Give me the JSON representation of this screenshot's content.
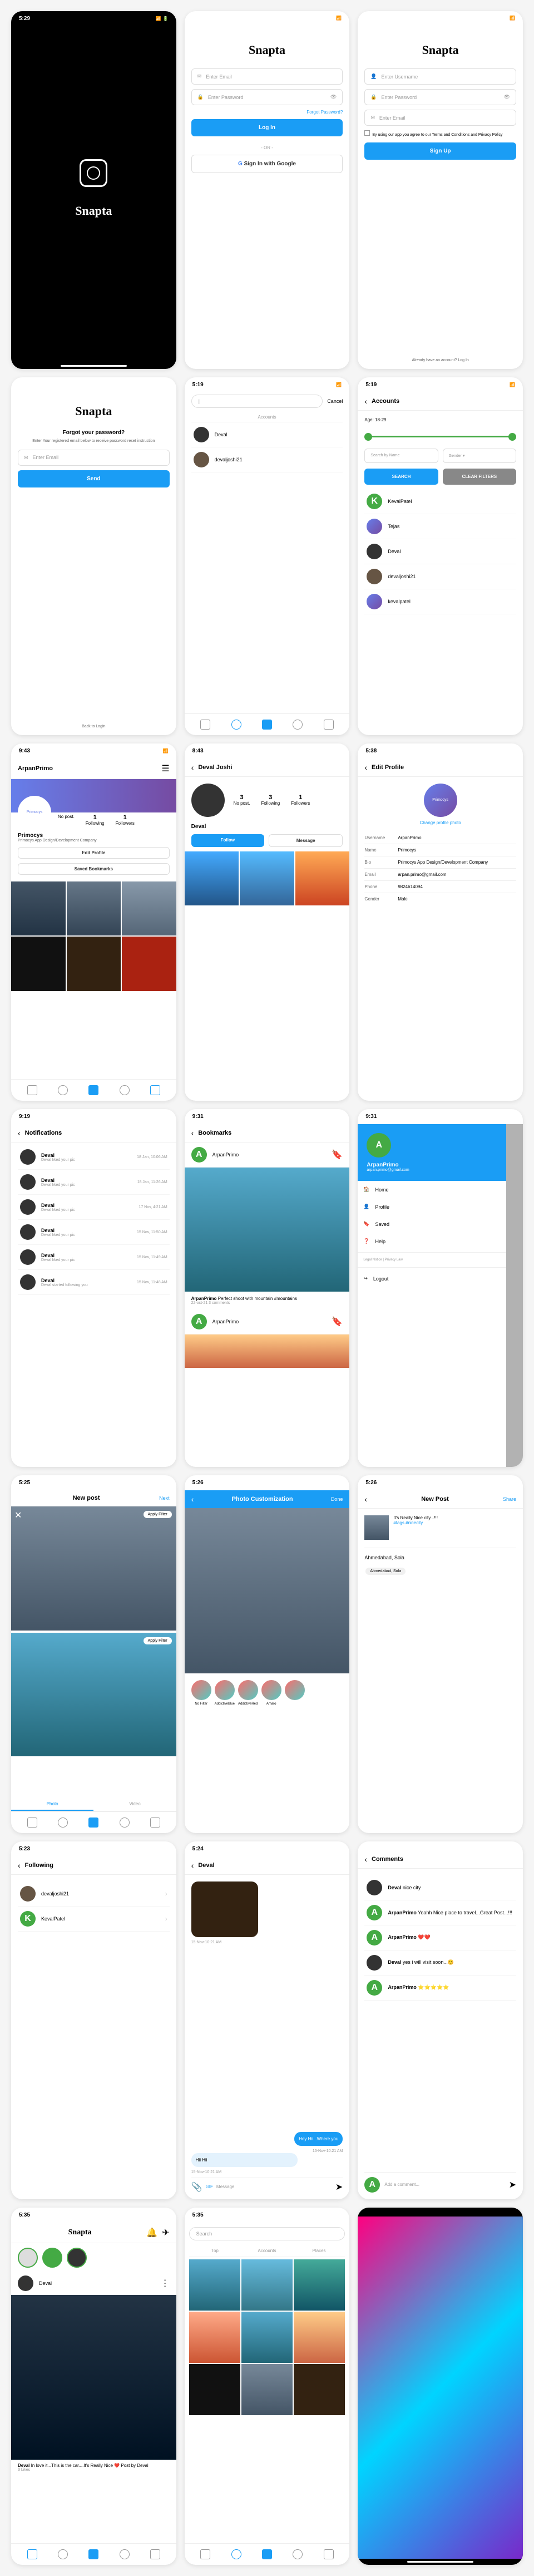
{
  "app_name": "Snapta",
  "times": {
    "t1": "5:29",
    "t2": "5:19",
    "t3": "9:43",
    "t4": "8:43",
    "t5": "5:38",
    "t6": "9:31",
    "t7": "9:19",
    "t8": "5:25",
    "t9": "5:26",
    "t10": "5:35",
    "t11": "5:23",
    "t12": "5:24"
  },
  "login": {
    "email_ph": "Enter Email",
    "password_ph": "Enter Password",
    "forgot": "Forgot Password?",
    "login_btn": "Log In",
    "google": "Sign In with Google",
    "signup": "Sign Up",
    "terms": "By using our app you agree to our Terms and Conditions and Privacy Policy",
    "footer": "Already have an account? Log In"
  },
  "forgot": {
    "title": "Forgot your password?",
    "desc": "Enter Your registered email below to receive password reset instruction",
    "btn": "Send",
    "back": "Back to Login"
  },
  "search": {
    "cancel": "Cancel",
    "tab": "Accounts",
    "ph": "Search"
  },
  "accounts": {
    "title": "Accounts",
    "age": "Age: 18-29",
    "search": "SEARCH",
    "clear": "CLEAR FILTERS",
    "list": [
      "KevalPatel",
      "Tejas",
      "Deval",
      "devaljoshi21",
      "kevalpatel"
    ]
  },
  "profile1": {
    "name": "ArpanPrimo",
    "username": "Primocys",
    "bio": "Primocys App Design/Development Company",
    "stats": [
      "No post.",
      "Following",
      "Followers"
    ],
    "nums": [
      "",
      "1",
      "1"
    ],
    "edit": "Edit Profile",
    "saved": "Saved Bookmarks"
  },
  "profile2": {
    "name": "Deval Joshi",
    "username": "Deval",
    "stats": [
      "No post.",
      "Following",
      "Followers"
    ],
    "nums": [
      "3",
      "3",
      "1"
    ],
    "follow": "Follow",
    "message": "Message"
  },
  "editprofile": {
    "title": "Edit Profile",
    "change": "Change profile photo",
    "fields": [
      "Username",
      "Name",
      "Bio",
      "Email",
      "Phone",
      "Gender"
    ],
    "values": [
      "ArpanPrimo",
      "Primocys",
      "Primocys App Design/Development Company",
      "arpan.primo@gmail.com",
      "9824614094",
      "Male"
    ]
  },
  "notifications": {
    "title": "Notifications",
    "user": "Deval",
    "msg": "Deval liked your pic",
    "msg2": "Deval started following you",
    "times": [
      "18 Jan, 10:06 AM",
      "18 Jan, 11:26 AM",
      "17 Nov, 4:21 AM",
      "15 Nov, 11:50 AM",
      "15 Nov, 11:49 AM",
      "15 Nov, 11:48 AM"
    ]
  },
  "bookmarks": {
    "title": "Bookmarks",
    "user": "ArpanPrimo",
    "caption": "Perfect shoot with mountain #mountains",
    "meta": "22-oct-21 3 comments"
  },
  "drawer": {
    "user": "ArpanPrimo",
    "email": "arpan.primo@gmail.com",
    "items": [
      "Home",
      "Profile",
      "Saved",
      "Help",
      "Logout"
    ],
    "legal": "Legal Notice | Privacy Law"
  },
  "newpost": {
    "title": "New post",
    "next": "Next",
    "filter": "Apply Filter",
    "tabs": [
      "Photo",
      "Video"
    ]
  },
  "customization": {
    "title": "Photo Customization",
    "done": "Done",
    "filters": [
      "No Filter",
      "AddictiveBlue",
      "AddictiveRed",
      "Amaro"
    ]
  },
  "newpost2": {
    "title": "New Post",
    "share": "Share",
    "caption": "It's Really Nice city...!!!",
    "tags": "#tags #nicecity",
    "city": "Ahmedabad, Sola",
    "chip": "Ahmedabad, Sola"
  },
  "following": {
    "title": "Following",
    "users": [
      "devaljoshi21",
      "KevalPatel"
    ]
  },
  "chat": {
    "name": "Deval",
    "msg1": "Hey Hii...Where you",
    "time1": "15-Nov-10:21 AM",
    "msg2": "Hii Hii",
    "time2": "15-Nov-10:21 AM",
    "gif": "GIF",
    "ph": "Message"
  },
  "comments": {
    "title": "Comments",
    "list": [
      {
        "u": "Deval",
        "t": "nice city"
      },
      {
        "u": "ArpanPrimo",
        "t": "Yeahh Nice place to travel...Great Post...!!!"
      },
      {
        "u": "ArpanPrimo",
        "t": "❤️❤️"
      },
      {
        "u": "Deval",
        "t": "yes i will visit soon...😊"
      },
      {
        "u": "ArpanPrimo",
        "t": "⭐⭐⭐⭐⭐"
      }
    ],
    "ph": "Add a comment..."
  },
  "feed": {
    "user": "Deval",
    "caption": "In love it...This is the car....It's Really Nice ❤️ Post by Deval",
    "likes": "3 Likes"
  },
  "searchpage": {
    "tabs": [
      "Top",
      "Accounts",
      "Places"
    ]
  },
  "users_list": [
    "Deval",
    "devaljoshi21"
  ]
}
